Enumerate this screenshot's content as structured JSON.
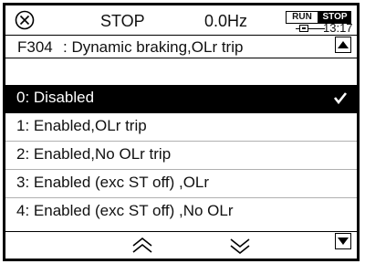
{
  "status": {
    "state": "STOP",
    "frequency": "0.0Hz",
    "run_indicator": "RUN",
    "stop_indicator": "STOP",
    "clock": "13:17"
  },
  "param_header": {
    "code": "F304",
    "title": ": Dynamic braking,OLr trip"
  },
  "options": [
    {
      "label": "0: Disabled",
      "selected": true
    },
    {
      "label": "1: Enabled,OLr trip",
      "selected": false
    },
    {
      "label": "2: Enabled,No OLr trip",
      "selected": false
    },
    {
      "label": "3: Enabled (exc ST off) ,OLr",
      "selected": false
    },
    {
      "label": "4: Enabled (exc ST off) ,No OLr",
      "selected": false
    }
  ],
  "icons": {
    "error": "circle-x-icon",
    "battery": "battery-icon",
    "scroll_up": "triangle-up-icon",
    "page_up": "double-chevron-up-icon",
    "page_down": "double-chevron-down-icon",
    "scroll_down": "triangle-down-icon",
    "check": "checkmark-icon"
  },
  "colors": {
    "selected_background": "#000000",
    "selected_text": "#ffffff",
    "text": "#111111"
  }
}
